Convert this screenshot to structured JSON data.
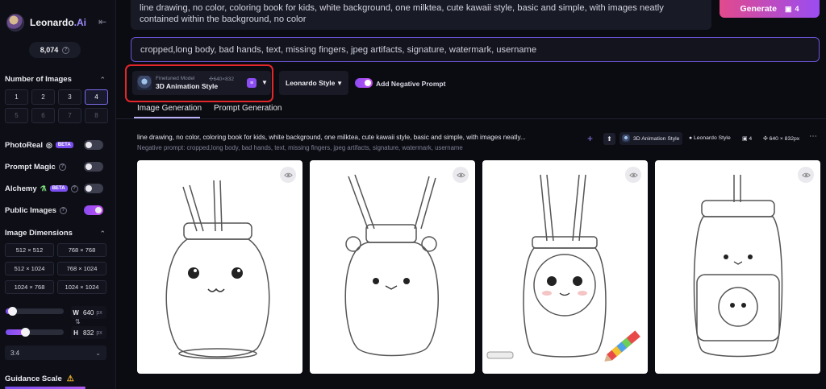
{
  "app": {
    "brand_main": "Leonardo",
    "brand_suffix": ".Ai",
    "tokens": "8,074"
  },
  "sidebar": {
    "number_of_images_title": "Number of Images",
    "number_options": [
      "1",
      "2",
      "3",
      "4",
      "5",
      "6",
      "7",
      "8"
    ],
    "selected_number": "4",
    "photoreal_label": "PhotoReal",
    "photoreal_badge": "BETA",
    "photoreal_on": false,
    "prompt_magic_label": "Prompt Magic",
    "prompt_magic_on": false,
    "alchemy_label": "Alchemy",
    "alchemy_badge": "BETA",
    "alchemy_on": false,
    "public_images_label": "Public Images",
    "public_images_on": true,
    "image_dimensions_title": "Image Dimensions",
    "dimension_options": [
      "512 × 512",
      "768 × 768",
      "512 × 1024",
      "768 × 1024",
      "1024 × 768",
      "1024 × 1024"
    ],
    "width_label": "W",
    "width_value": "640",
    "height_label": "H",
    "height_value": "832",
    "unit": "px",
    "aspect_ratio": "3:4",
    "guidance_scale_title": "Guidance Scale"
  },
  "prompt": {
    "text": "line drawing, no color, coloring book for kids, white background, one milktea, cute kawaii style, basic and simple, with images neatly contained within the background, no color",
    "negative_text": "cropped,long body, bad hands, text, missing fingers, jpeg artifacts, signature, watermark, username",
    "generate_label": "Generate",
    "generate_count": "4"
  },
  "controls": {
    "model_label": "Finetuned Model",
    "model_size": "640×832",
    "model_name": "3D Animation Style",
    "style_label": "Leonardo Style",
    "negative_prompt_toggle_label": "Add Negative Prompt",
    "negative_prompt_on": true
  },
  "tabs": {
    "image_generation": "Image Generation",
    "prompt_generation": "Prompt Generation"
  },
  "generation": {
    "prompt_preview": "line drawing, no color, coloring book for kids, white background, one milktea, cute kawaii style, basic and simple, with images neatly...",
    "negative_preview": "Negative prompt: cropped,long body, bad hands, text, missing fingers, jpeg artifacts, signature, watermark, username",
    "model_tag": "3D Animation Style",
    "style_tag": "Leonardo Style",
    "count_tag": "4",
    "size_tag": "640 × 832px"
  },
  "colors": {
    "accent_purple": "#8a4cf2",
    "generate_gradient_start": "#e24a8c",
    "highlight_red": "#e3262a"
  }
}
